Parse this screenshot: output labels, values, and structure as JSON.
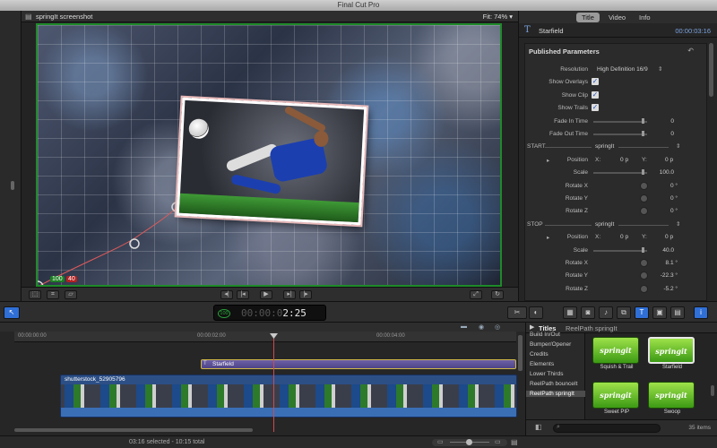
{
  "app": {
    "title": "Final Cut Pro"
  },
  "viewer": {
    "clip_name": "springIt screenshot",
    "fit_label": "Fit:",
    "fit_value": "74%",
    "badge_green": "100",
    "badge_red": "40"
  },
  "inspector": {
    "tabs": [
      "Title",
      "Video",
      "Info"
    ],
    "active_tab": "Title",
    "title": "Starfield",
    "duration": "00:00:03:16",
    "section": "Published Parameters",
    "params": [
      {
        "label": "Resolution",
        "type": "select",
        "value": "High Definition 16/9"
      },
      {
        "label": "Show Overlays",
        "type": "check",
        "value": "✓"
      },
      {
        "label": "Show Clip",
        "type": "check",
        "value": "✓"
      },
      {
        "label": "Show Trails",
        "type": "check",
        "value": "✓"
      },
      {
        "label": "Fade In Time",
        "type": "slider",
        "value": "0"
      },
      {
        "label": "Fade Out Time",
        "type": "slider",
        "value": "0"
      },
      {
        "label": "START",
        "type": "group",
        "value": "springIt"
      },
      {
        "label": "Position",
        "type": "xy",
        "x_label": "X:",
        "x": "0",
        "unit": "p",
        "y_label": "Y:",
        "y": "0"
      },
      {
        "label": "Scale",
        "type": "slider",
        "value": "100.0"
      },
      {
        "label": "Rotate X",
        "type": "knob",
        "value": "0",
        "unit": "°"
      },
      {
        "label": "Rotate Y",
        "type": "knob",
        "value": "0",
        "unit": "°"
      },
      {
        "label": "Rotate Z",
        "type": "knob",
        "value": "0",
        "unit": "°"
      },
      {
        "label": "STOP",
        "type": "group",
        "value": "springIt"
      },
      {
        "label": "Position",
        "type": "xy",
        "x_label": "X:",
        "x": "0",
        "unit": "p",
        "y_label": "Y:",
        "y": "0"
      },
      {
        "label": "Scale",
        "type": "slider",
        "value": "40.0"
      },
      {
        "label": "Rotate X",
        "type": "knob",
        "value": "8.1",
        "unit": "°"
      },
      {
        "label": "Rotate Y",
        "type": "knob",
        "value": "-22.3",
        "unit": "°"
      },
      {
        "label": "Rotate Z",
        "type": "knob",
        "value": "-5.2",
        "unit": "°"
      }
    ]
  },
  "timecode": {
    "badge": "100",
    "dim": "00:00:0",
    "bright": "2:25"
  },
  "timeline": {
    "ruler": [
      "00:00:00:00",
      "00:00:02:00",
      "00:00:04:00"
    ],
    "title_clip": "Starfield",
    "video_clip": "shutterstock_52905796"
  },
  "browser": {
    "title": "Titles",
    "subtitle": "ReelPath springIt",
    "categories": [
      "Build In/Out",
      "Bumper/Opener",
      "Credits",
      "Elements",
      "Lower Thirds",
      "ReelPath bounceIt",
      "ReelPath springIt"
    ],
    "selected_category": "ReelPath springIt",
    "items": [
      {
        "logo": "springit",
        "label": "Squish & Trail"
      },
      {
        "logo": "springit",
        "label": "Starfield"
      },
      {
        "logo": "springit",
        "label": "Sweet PIP"
      },
      {
        "logo": "springit",
        "label": "Swoop"
      }
    ],
    "selected_item": "Starfield",
    "count": "35 items"
  },
  "status": {
    "text": "03:16 selected - 10:15 total"
  },
  "icons": {
    "viewer": [
      "film-icon"
    ],
    "toolbar": [
      "arrow-tool-icon",
      "blade-icon",
      "snapshot-icon",
      "camera-icon",
      "music-icon",
      "title-icon",
      "generator-icon",
      "theme-icon",
      "info-icon"
    ]
  }
}
